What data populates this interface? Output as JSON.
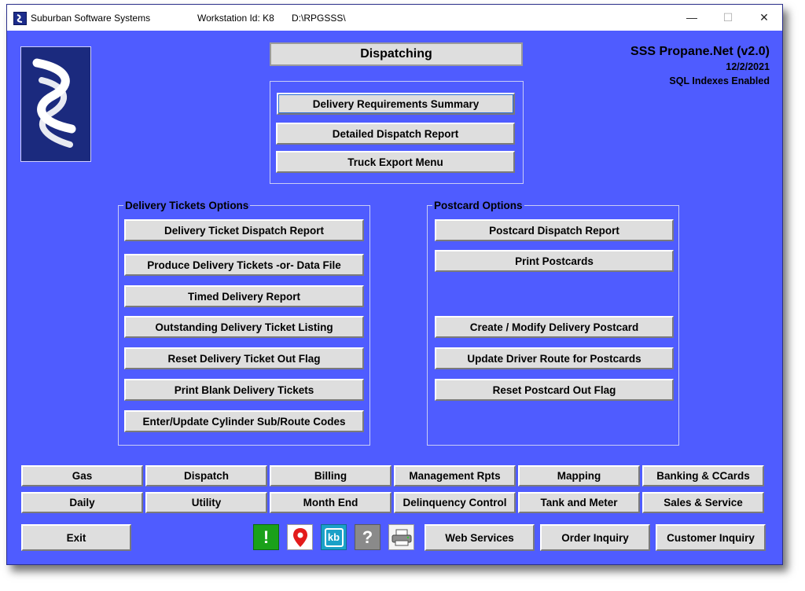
{
  "window": {
    "app_title": "Suburban Software Systems",
    "workstation": "Workstation Id: K8",
    "path": "D:\\RPGSSS\\",
    "minimize": "—",
    "maximize": "☐",
    "close": "✕"
  },
  "header": {
    "screen_title": "Dispatching",
    "product": "SSS Propane.Net (v2.0)",
    "date": "12/2/2021",
    "sql_status": "SQL Indexes Enabled"
  },
  "top_buttons": [
    "Delivery Requirements Summary",
    "Detailed Dispatch Report",
    "Truck Export Menu"
  ],
  "delivery_group": {
    "legend": "Delivery Tickets Options",
    "buttons": [
      "Delivery Ticket Dispatch Report",
      "Produce Delivery Tickets -or- Data File",
      "Timed Delivery Report",
      "Outstanding Delivery Ticket Listing",
      "Reset Delivery Ticket Out Flag",
      "Print Blank Delivery Tickets",
      "Enter/Update Cylinder Sub/Route Codes"
    ]
  },
  "postcard_group": {
    "legend": "Postcard Options",
    "buttons": [
      "Postcard Dispatch Report",
      "Print Postcards",
      "Create / Modify Delivery Postcard",
      "Update Driver Route for Postcards",
      "Reset Postcard Out Flag"
    ]
  },
  "nav_row1": [
    "Gas",
    "Dispatch",
    "Billing",
    "Management Rpts",
    "Mapping",
    "Banking & CCards"
  ],
  "nav_row2": [
    "Daily",
    "Utility",
    "Month End",
    "Delinquency Control",
    "Tank and Meter",
    "Sales & Service"
  ],
  "bottom": {
    "exit": "Exit",
    "web_services": "Web Services",
    "order_inquiry": "Order Inquiry",
    "customer_inquiry": "Customer Inquiry",
    "kb_label": "kb",
    "alert_label": "!",
    "help_label": "?"
  },
  "icons": [
    "alert-icon",
    "map-pin-icon",
    "kb-icon",
    "help-icon",
    "printer-icon"
  ],
  "colors": {
    "background": "#4f5cff",
    "button": "#dedede",
    "logo": "#1b2a7e"
  }
}
